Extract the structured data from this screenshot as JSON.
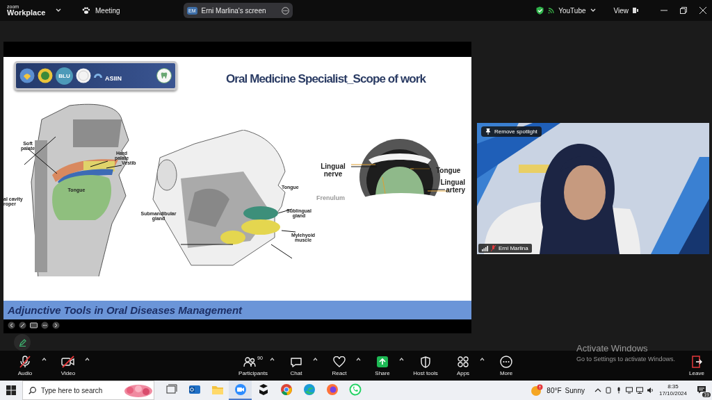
{
  "title_bar": {
    "logo_top": "zoom",
    "logo_bottom": "Workplace",
    "meeting": "Meeting",
    "share": {
      "initials": "EM",
      "label": "Erni Marlina's screen"
    },
    "youtube": "YouTube",
    "view": "View"
  },
  "slide": {
    "logo_texts": [
      "BLU",
      "ASIIN"
    ],
    "title": "Oral Medicine Specialist_Scope of work",
    "figures": [
      {
        "labels": [
          "Soft palate",
          "Hard palate",
          "Vestib",
          "al cavity roper",
          "Tongue"
        ]
      },
      {
        "labels": [
          "Tongue",
          "Submandibular gland",
          "Sublingual gland",
          "Mylehyoid muscle"
        ]
      },
      {
        "labels": [
          "Lingual nerve",
          "Tongue",
          "Lingual artery",
          "Frenulum"
        ]
      }
    ],
    "footer": "Adjunctive Tools in Oral Diseases Management"
  },
  "video": {
    "spotlight_button": "Remove spotlight",
    "name": "Erni Marlina",
    "muted": true
  },
  "toolbar": [
    {
      "kind": "audio",
      "label": "Audio",
      "muted": true,
      "menu": true
    },
    {
      "kind": "video",
      "label": "Video",
      "muted": true,
      "menu": true
    },
    {
      "kind": "participants",
      "label": "Participants",
      "count": "90",
      "menu": true
    },
    {
      "kind": "chat",
      "label": "Chat",
      "menu": true
    },
    {
      "kind": "react",
      "label": "React",
      "menu": true
    },
    {
      "kind": "share",
      "label": "Share",
      "menu": true
    },
    {
      "kind": "host",
      "label": "Host tools",
      "menu": false
    },
    {
      "kind": "apps",
      "label": "Apps",
      "menu": true
    },
    {
      "kind": "more",
      "label": "More",
      "menu": false
    },
    {
      "kind": "leave",
      "label": "Leave",
      "menu": false
    }
  ],
  "activation": {
    "title": "Activate Windows",
    "hint": "Go to Settings to activate Windows."
  },
  "taskbar": {
    "search_placeholder": "Type here to search",
    "apps": [
      {
        "kind": "task-view",
        "active": false
      },
      {
        "kind": "mail",
        "active": false
      },
      {
        "kind": "folder",
        "active": false
      },
      {
        "kind": "zoom",
        "active": true
      },
      {
        "kind": "editor",
        "active": false
      },
      {
        "kind": "chrome",
        "active": false
      },
      {
        "kind": "edge",
        "active": false
      },
      {
        "kind": "firefox",
        "active": false
      },
      {
        "kind": "whatsapp",
        "active": false
      }
    ],
    "weather": {
      "temp": "80°F",
      "condition": "Sunny"
    },
    "time": "8:35",
    "date": "17/10/2024",
    "notifications": "19"
  }
}
